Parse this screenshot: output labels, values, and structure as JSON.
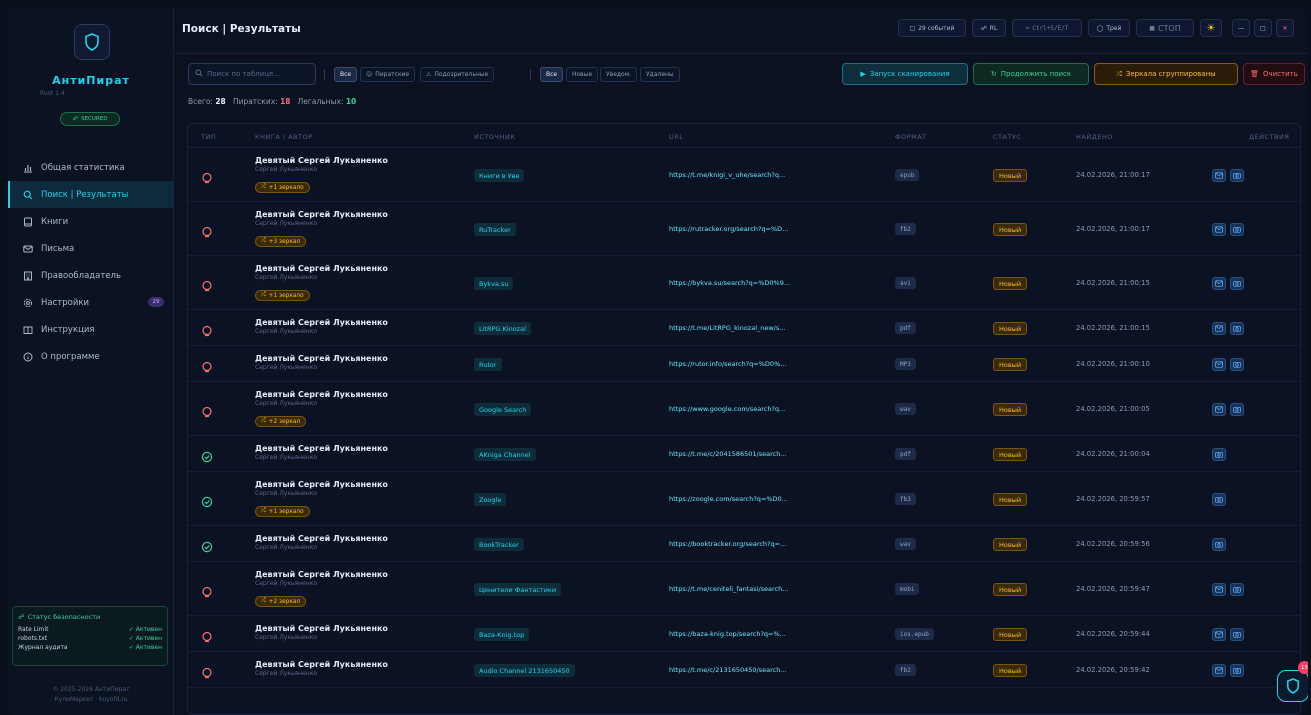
{
  "sidebar": {
    "app_name": "АнтиПират",
    "app_sub": "Rust 1.4",
    "secured_label": "SECURED",
    "nav": [
      {
        "label": "Общая статистика",
        "icon": "bar-chart-icon"
      },
      {
        "label": "Поиск | Результаты",
        "icon": "search-icon",
        "active": true
      },
      {
        "label": "Книги",
        "icon": "book-icon"
      },
      {
        "label": "Письма",
        "icon": "mail-icon"
      },
      {
        "label": "Правообладатель",
        "icon": "building-icon"
      },
      {
        "label": "Настройки",
        "icon": "gear-icon",
        "badge": "29"
      },
      {
        "label": "Инструкция",
        "icon": "open-book-icon"
      },
      {
        "label": "О программе",
        "icon": "info-icon"
      }
    ],
    "security": {
      "title": "Статус безопасности",
      "rows": [
        {
          "name": "Rate Limit",
          "value": "Активен"
        },
        {
          "name": "robots.txt",
          "value": "Активен"
        },
        {
          "name": "Журнал аудита",
          "value": "Активен"
        }
      ]
    },
    "copyright_line1": "© 2025-2026 АнтиПират",
    "copyright_line2": "КулиМаркет · kuyofd.ru"
  },
  "header": {
    "title": "Поиск | Результаты",
    "events": "29 событий",
    "rl": "RL",
    "shortcut": "Ctrl+S/E/T",
    "tray": "Трей",
    "stop": "СТОП"
  },
  "toolbar": {
    "search_placeholder": "Поиск по таблице...",
    "filter_type": [
      "Все",
      "Пиратские",
      "Подозрительные"
    ],
    "filter_status": [
      "Все",
      "Новые",
      "Уведом.",
      "Удалены"
    ],
    "btn_scan": "Запуск сканирования",
    "btn_continue": "Продолжить поиск",
    "btn_mirrors": "Зеркала сгруппированы",
    "btn_clear": "Очистить"
  },
  "counts": {
    "total_label": "Всего:",
    "total": "28",
    "pirate_label": "Пиратских:",
    "pirate": "18",
    "legal_label": "Легальных:",
    "legal": "10"
  },
  "table": {
    "headers": [
      "ТИП",
      "КНИГА / АВТОР",
      "ИСТОЧНИК",
      "URL",
      "ФОРМАТ",
      "СТАТУС",
      "НАЙДЕНО",
      "ДЕЙСТВИЯ"
    ],
    "rows": [
      {
        "type": "pirate",
        "title": "Девятый Сергей Лукьяненко",
        "author": "Сергей Лукьяненко",
        "mirror": "+1 зеркало",
        "source": "Книги в Уве",
        "url": "https://t.me/knigi_v_uhe/search?q...",
        "format": "epub",
        "status": "Новый",
        "found": "24.02.2026, 21:00:17",
        "mail": true
      },
      {
        "type": "pirate",
        "title": "Девятый Сергей Лукьяненко",
        "author": "Сергей Лукьяненко",
        "mirror": "+3 зеркал",
        "source": "RuTracker",
        "url": "https://rutracker.org/search?q=%D...",
        "format": "fb2",
        "status": "Новый",
        "found": "24.02.2026, 21:00:17",
        "mail": true
      },
      {
        "type": "pirate",
        "title": "Девятый Сергей Лукьяненко",
        "author": "Сергей Лукьяненко",
        "mirror": "+1 зеркало",
        "source": "Bykva.su",
        "url": "https://bykva.su/search?q=%D0%9...",
        "format": "avi",
        "status": "Новый",
        "found": "24.02.2026, 21:00:15",
        "mail": true
      },
      {
        "type": "pirate",
        "title": "Девятый Сергей Лукьяненко",
        "author": "Сергей Лукьяненко",
        "mirror": "",
        "source": "LitRPG Kinozal",
        "url": "https://t.me/LitRPG_kinozal_new/s...",
        "format": "pdf",
        "status": "Новый",
        "found": "24.02.2026, 21:00:15",
        "mail": true
      },
      {
        "type": "pirate",
        "title": "Девятый Сергей Лукьяненко",
        "author": "Сергей Лукьяненко",
        "mirror": "",
        "source": "Rutor",
        "url": "https://rutor.info/search?q=%D0%...",
        "format": "MP3",
        "status": "Новый",
        "found": "24.02.2026, 21:00:10",
        "mail": true
      },
      {
        "type": "pirate",
        "title": "Девятый Сергей Лукьяненко",
        "author": "Сергей Лукьяненко",
        "mirror": "+2 зеркал",
        "source": "Google Search",
        "url": "https://www.google.com/search?q...",
        "format": "wav",
        "status": "Новый",
        "found": "24.02.2026, 21:00:05",
        "mail": true
      },
      {
        "type": "legal",
        "title": "Девятый Сергей Лукьяненко",
        "author": "Сергей Лукьяненко",
        "mirror": "",
        "source": "AKniga Channel",
        "url": "https://t.me/c/2041586501/search...",
        "format": "pdf",
        "status": "Новый",
        "found": "24.02.2026, 21:00:04",
        "mail": false
      },
      {
        "type": "legal",
        "title": "Девятый Сергей Лукьяненко",
        "author": "Сергей Лукьяненко",
        "mirror": "+1 зеркало",
        "source": "Zoogle",
        "url": "https://zoogle.com/search?q=%D0...",
        "format": "fb3",
        "status": "Новый",
        "found": "24.02.2026, 20:59:57",
        "mail": false
      },
      {
        "type": "legal",
        "title": "Девятый Сергей Лукьяненко",
        "author": "Сергей Лукьяненко",
        "mirror": "",
        "source": "BookTracker",
        "url": "https://booktracker.org/search?q=...",
        "format": "wav",
        "status": "Новый",
        "found": "24.02.2026, 20:59:56",
        "mail": false
      },
      {
        "type": "pirate",
        "title": "Девятый Сергей Лукьяненко",
        "author": "Сергей Лукьяненко",
        "mirror": "+2 зеркал",
        "source": "Ценители Фантастики",
        "url": "https://t.me/ceniteli_fantasi/search...",
        "format": "mobi",
        "status": "Новый",
        "found": "24.02.2026, 20:59:47",
        "mail": true
      },
      {
        "type": "pirate",
        "title": "Девятый Сергей Лукьяненко",
        "author": "Сергей Лукьяненко",
        "mirror": "",
        "source": "Baza-Knig.top",
        "url": "https://baza-knig.top/search?q=%...",
        "format": "ios.epub",
        "status": "Новый",
        "found": "24.02.2026, 20:59:44",
        "mail": true
      },
      {
        "type": "pirate",
        "title": "Девятый Сергей Лукьяненко",
        "author": "Сергей Лукьяненко",
        "mirror": "",
        "source": "Audio Channel 2131650450",
        "url": "https://t.me/c/2131650450/search...",
        "format": "fb2",
        "status": "Новый",
        "found": "24.02.2026, 20:59:42",
        "mail": true
      }
    ]
  },
  "fab_badge": "15",
  "colors": {
    "accent": "#22d3ee",
    "pirate": "#f87171",
    "legal": "#34d399",
    "warning": "#fbbf24"
  }
}
